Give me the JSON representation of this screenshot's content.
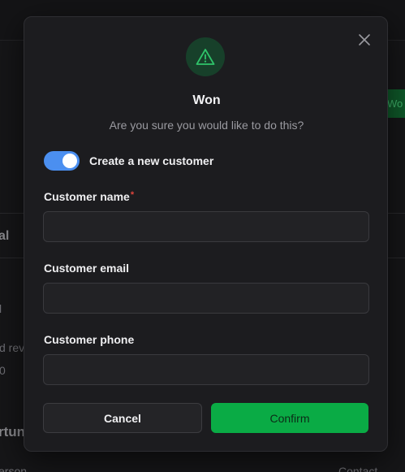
{
  "background": {
    "won_badge": "Wo",
    "section_fragment": "al",
    "row_fragment_1": "l",
    "row_fragment_2": "d rev",
    "row_fragment_3": "0",
    "heading_fragment": "rtun",
    "col_left_fragment": "erson",
    "col_right_fragment": "Contact"
  },
  "modal": {
    "title": "Won",
    "subtitle": "Are you sure you would like to do this?",
    "toggle": {
      "label": "Create a new customer",
      "checked": true
    },
    "fields": {
      "name": {
        "label": "Customer name",
        "required_mark": "*",
        "value": "",
        "placeholder": ""
      },
      "email": {
        "label": "Customer email",
        "value": "",
        "placeholder": ""
      },
      "phone": {
        "label": "Customer phone",
        "value": "",
        "placeholder": ""
      }
    },
    "buttons": {
      "cancel": "Cancel",
      "confirm": "Confirm"
    },
    "icons": {
      "status": "warning-triangle-icon",
      "close": "close-icon"
    }
  },
  "colors": {
    "accent_green": "#0aab45",
    "toggle_blue": "#4b8ff0",
    "warning_green": "#2fc46a"
  }
}
